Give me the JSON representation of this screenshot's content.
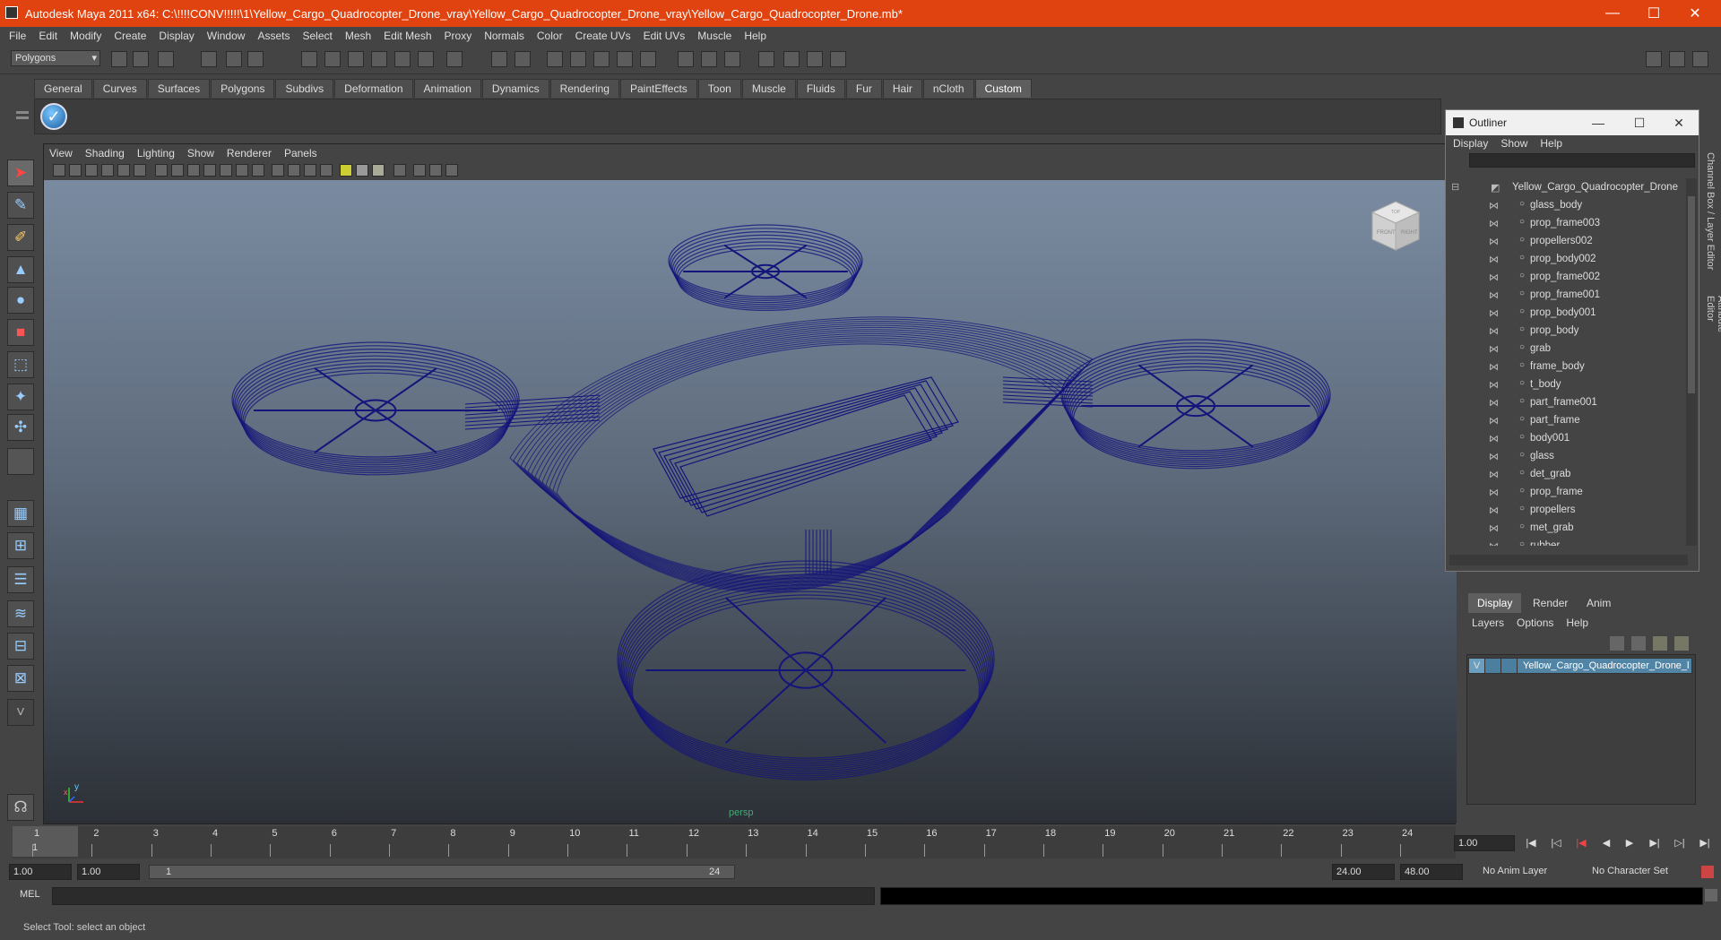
{
  "window": {
    "title": "Autodesk Maya 2011 x64: C:\\!!!!CONV!!!!!\\1\\Yellow_Cargo_Quadrocopter_Drone_vray\\Yellow_Cargo_Quadrocopter_Drone_vray\\Yellow_Cargo_Quadrocopter_Drone.mb*",
    "min": "—",
    "max": "☐",
    "close": "✕"
  },
  "menubar": [
    "File",
    "Edit",
    "Modify",
    "Create",
    "Display",
    "Window",
    "Assets",
    "Select",
    "Mesh",
    "Edit Mesh",
    "Proxy",
    "Normals",
    "Color",
    "Create UVs",
    "Edit UVs",
    "Muscle",
    "Help"
  ],
  "statusline": {
    "mode": "Polygons"
  },
  "shelf": {
    "tabs": [
      "General",
      "Curves",
      "Surfaces",
      "Polygons",
      "Subdivs",
      "Deformation",
      "Animation",
      "Dynamics",
      "Rendering",
      "PaintEffects",
      "Toon",
      "Muscle",
      "Fluids",
      "Fur",
      "Hair",
      "nCloth",
      "Custom"
    ],
    "active": "Custom",
    "button_glyph": "✓"
  },
  "viewport": {
    "menu": [
      "View",
      "Shading",
      "Lighting",
      "Show",
      "Renderer",
      "Panels"
    ],
    "camera": "persp",
    "viewcube": {
      "top": "TOP",
      "front": "FRONT",
      "right": "RIGHT"
    },
    "axis_x": "x",
    "axis_y": "y",
    "wire_color": "#14147a"
  },
  "outliner": {
    "title": "Outliner",
    "menu": [
      "Display",
      "Show",
      "Help"
    ],
    "root": "Yellow_Cargo_Quadrocopter_Drone",
    "items": [
      "glass_body",
      "prop_frame003",
      "propellers002",
      "prop_body002",
      "prop_frame002",
      "prop_frame001",
      "prop_body001",
      "prop_body",
      "grab",
      "frame_body",
      "t_body",
      "part_frame001",
      "part_frame",
      "body001",
      "glass",
      "det_grab",
      "prop_frame",
      "propellers",
      "met_grab",
      "rubber"
    ]
  },
  "layers": {
    "tabs": [
      "Display",
      "Render",
      "Anim"
    ],
    "active": "Display",
    "menu": [
      "Layers",
      "Options",
      "Help"
    ],
    "layer_visible": "V",
    "layer_name": "Yellow_Cargo_Quadrocopter_Drone_l"
  },
  "side_tabs": [
    "Channel Box / Layer Editor",
    "Attribute Editor"
  ],
  "timeline": {
    "ticks": [
      "1",
      "2",
      "3",
      "4",
      "5",
      "6",
      "7",
      "8",
      "9",
      "10",
      "11",
      "12",
      "13",
      "14",
      "15",
      "16",
      "17",
      "18",
      "19",
      "20",
      "21",
      "22",
      "23",
      "24"
    ],
    "current": "1",
    "current_field": "1.00"
  },
  "range": {
    "start": "1.00",
    "playback_start": "1.00",
    "bar_start": "1",
    "bar_end": "24",
    "playback_end": "24.00",
    "end": "48.00",
    "anim_layer": "No Anim Layer",
    "character_set": "No Character Set"
  },
  "command": {
    "label": "MEL"
  },
  "help": {
    "text": "Select Tool: select an object"
  }
}
